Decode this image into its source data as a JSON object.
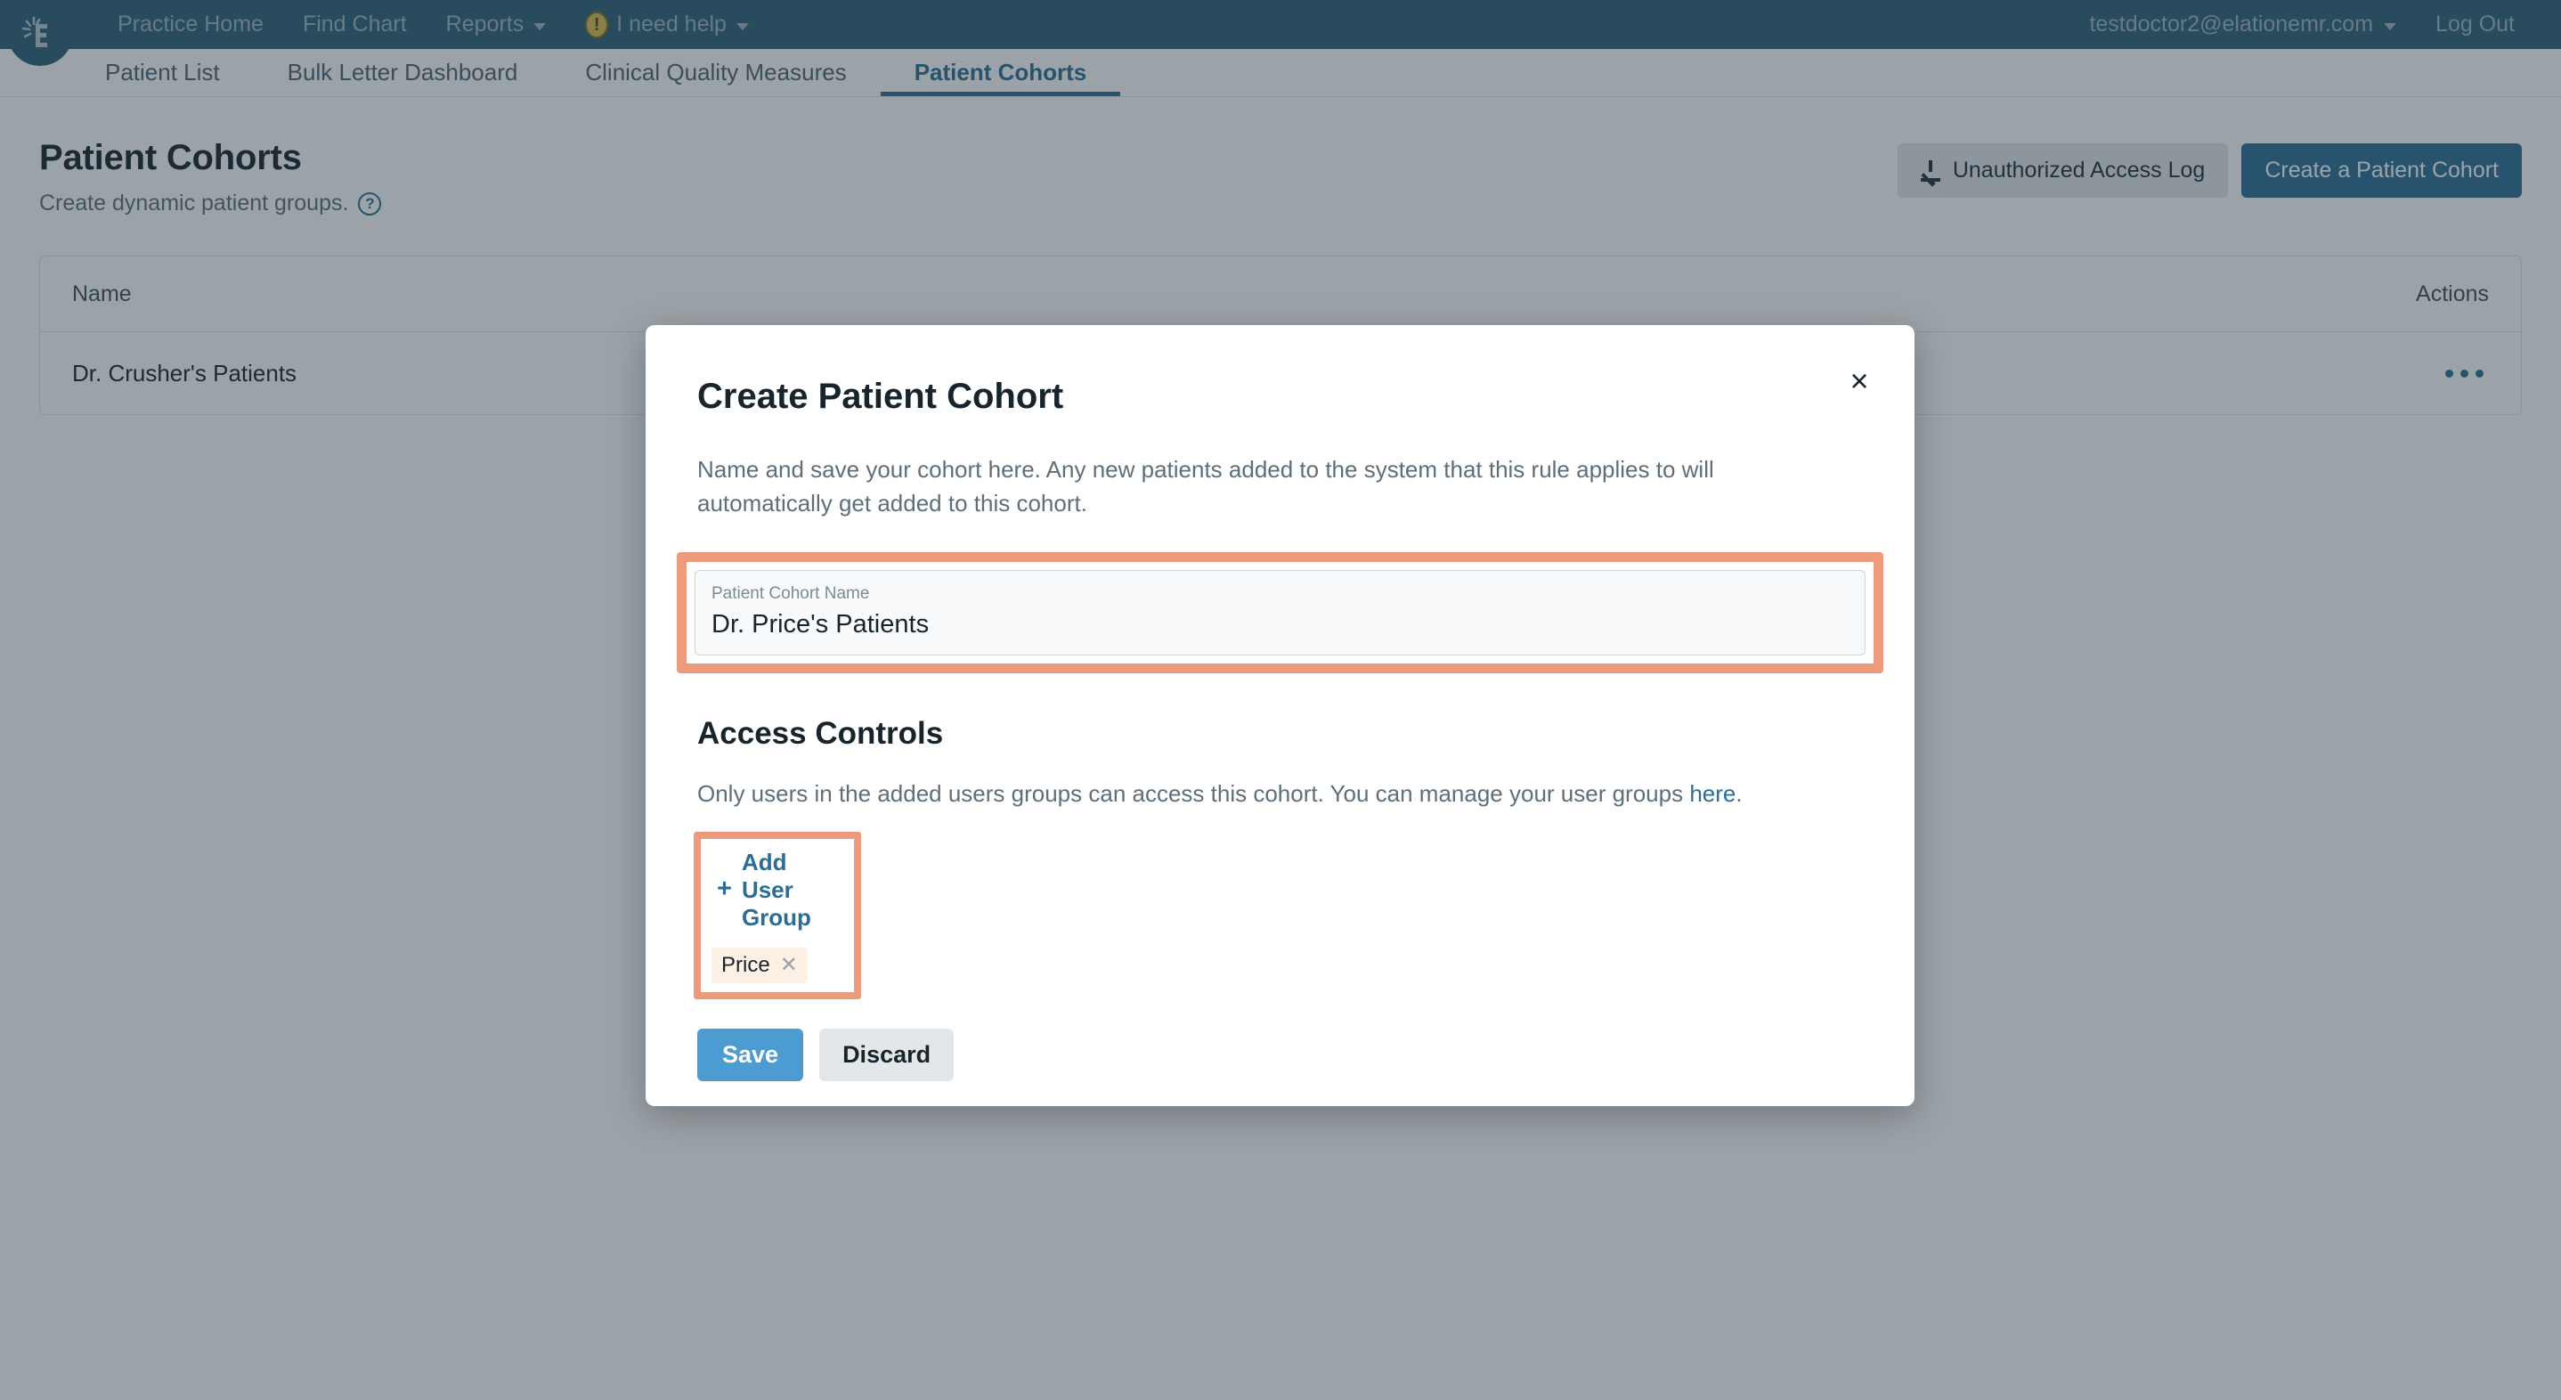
{
  "topbar": {
    "logo_alt": "Elation EMR",
    "nav": [
      {
        "label": "Practice Home",
        "has_caret": false
      },
      {
        "label": "Find Chart",
        "has_caret": false
      },
      {
        "label": "Reports",
        "has_caret": true
      },
      {
        "label": "I need help",
        "has_caret": true,
        "icon": "warning-icon"
      }
    ],
    "account_email": "testdoctor2@elationemr.com",
    "log_out_label": "Log Out",
    "background_color": "#2c5f77"
  },
  "subnav": {
    "items": [
      {
        "label": "Patient List",
        "active": false
      },
      {
        "label": "Bulk Letter Dashboard",
        "active": false
      },
      {
        "label": "Clinical Quality Measures",
        "active": false
      },
      {
        "label": "Patient Cohorts",
        "active": true
      }
    ],
    "active_color": "#2b6d95"
  },
  "page": {
    "title": "Patient Cohorts",
    "subtitle": "Create dynamic patient groups.",
    "help_glyph": "?",
    "actions": {
      "unauthorized_access_log": "Unauthorized Access Log",
      "create_cohort": "Create a Patient Cohort"
    }
  },
  "table": {
    "headers": {
      "name": "Name",
      "actions": "Actions"
    },
    "rows": [
      {
        "name": "Dr. Crusher's Patients"
      }
    ]
  },
  "modal": {
    "title": "Create Patient Cohort",
    "close_glyph": "×",
    "description": "Name and save your cohort here. Any new patients added to the system that this rule applies to will automatically get added to this cohort.",
    "name_field": {
      "label": "Patient Cohort Name",
      "value": "Dr. Price's Patients",
      "placeholder": "Patient Cohort Name",
      "highlight_color": "#ee9b7d"
    },
    "access_controls": {
      "title": "Access Controls",
      "description_before": "Only users in the added users groups can access this cohort. You can manage your user groups ",
      "link_label": "here",
      "description_after": ".",
      "add_user_group_label": "Add User Group",
      "add_plus_glyph": "+",
      "chips": [
        {
          "label": "Price",
          "remove_glyph": "✕"
        }
      ],
      "highlight_color": "#ee9b7d"
    },
    "footer": {
      "save_label": "Save",
      "discard_label": "Discard",
      "save_color": "#4c9cd1"
    }
  }
}
